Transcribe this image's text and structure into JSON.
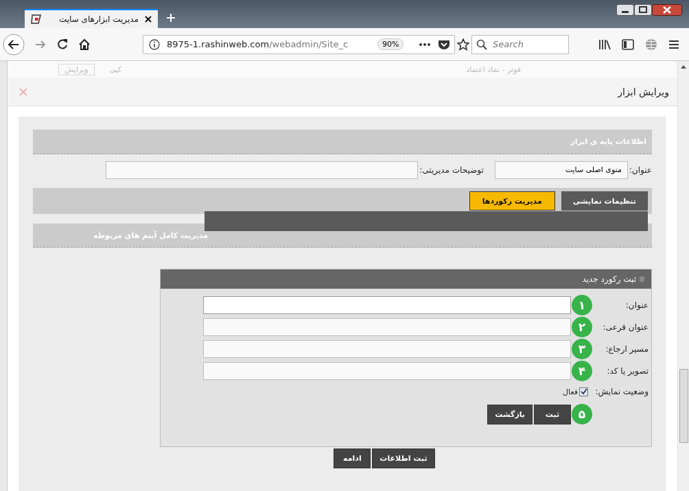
{
  "browser": {
    "tab_title": "مدیریت ابزارهای سایت",
    "url_host": "8975-1.rashinweb.com",
    "url_path": "/webadmin/Site_c",
    "zoom": "90%",
    "search_placeholder": "Search"
  },
  "background_page": {
    "items": [
      "فوتر - نماد اعتماد",
      "کپی",
      "ویرایش"
    ]
  },
  "modal": {
    "title": "ویرایش ابزار",
    "basic_section": {
      "heading": "اطلاعات پایه ی ابزار",
      "fields": [
        {
          "label": "عنوان:",
          "value": "منوی اصلی سایت"
        },
        {
          "label": "توضیحات مدیریتی:"
        }
      ]
    },
    "tabs": [
      {
        "label": "تنظیمات نمایشی",
        "selected": false
      },
      {
        "label": "مدیریت رکوردها",
        "selected": true
      }
    ],
    "related_row": "مدیریت کامل آیتم های مربوطه",
    "record_form": {
      "title": "ثبت رکورد جدید",
      "fields": [
        {
          "label": "عنوان:",
          "badge": "۱",
          "focused": true
        },
        {
          "label": "عنوان فرعی:",
          "badge": "۲",
          "focused": false
        },
        {
          "label": "مسیر ارجاع:",
          "badge": "۳",
          "focused": false
        },
        {
          "label": "تصویر یا کد:",
          "badge": "۴",
          "focused": false
        }
      ],
      "status": {
        "label": "وضعیت نمایش:",
        "option": "فعال",
        "checked": true
      },
      "badge": "۵",
      "buttons": [
        "ثبت",
        "بازگشت"
      ]
    },
    "footer_buttons": [
      "ثبت اطلاعات",
      "ادامه"
    ]
  }
}
